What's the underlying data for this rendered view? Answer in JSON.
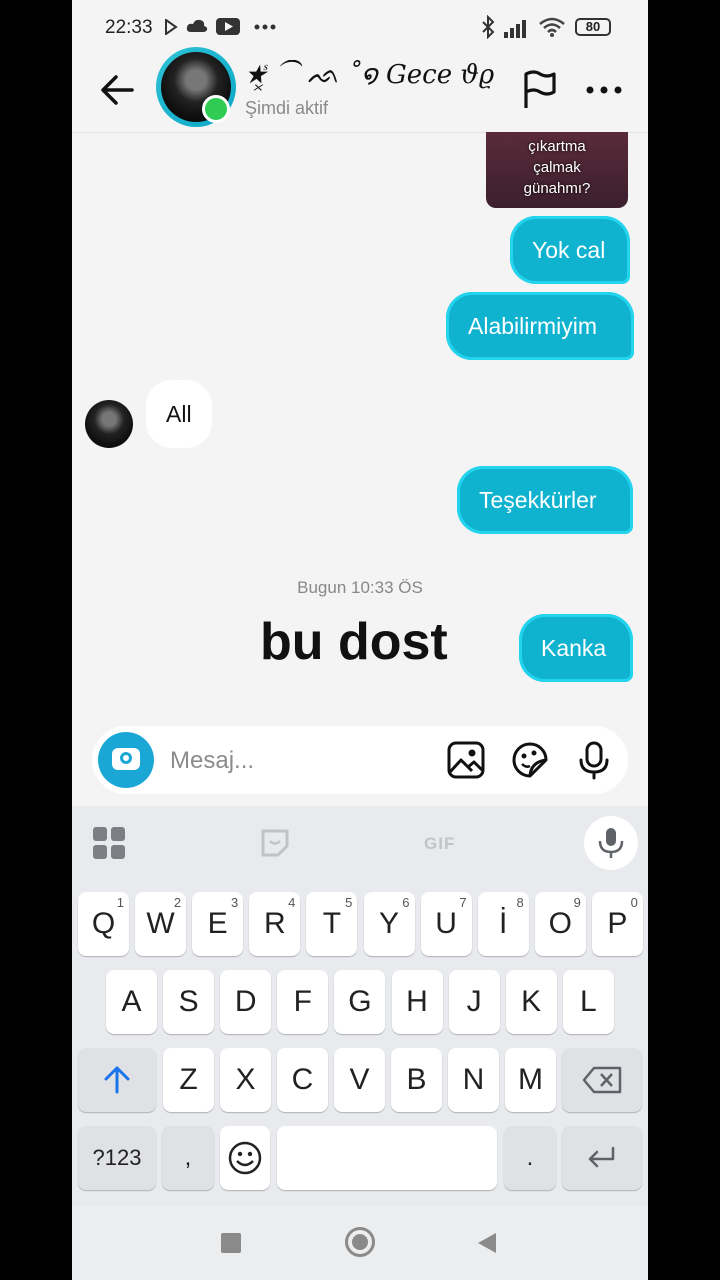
{
  "status_bar": {
    "time": "22:33",
    "battery": "80",
    "icons": [
      "play-store-icon",
      "cloud-icon",
      "youtube-icon",
      "more-dots-icon",
      "bluetooth-icon",
      "signal-icon",
      "wifi-icon",
      "battery-icon"
    ]
  },
  "header": {
    "contact_name": "★͓ᷤ ⁀ ᨒ ˚໑ Gece ϑϱ˚...",
    "status": "Şimdi aktif",
    "icons": [
      "back-arrow-icon",
      "flag-icon",
      "more-options-icon"
    ],
    "online_color": "#2ecc52"
  },
  "messages": [
    {
      "direction": "outgoing",
      "type": "sticker",
      "text": "çıkartma\nçalmak\ngünahmı?"
    },
    {
      "direction": "outgoing",
      "text": "Yok cal"
    },
    {
      "direction": "outgoing",
      "text": "Alabilirmiyim"
    },
    {
      "direction": "incoming",
      "text": "All"
    },
    {
      "direction": "outgoing",
      "text": "Teşekkürler"
    },
    {
      "direction": "outgoing",
      "text": "Kanka"
    }
  ],
  "timestamp": "Bugun 10:33 ÖS",
  "overlay_text": "bu dost",
  "composer": {
    "placeholder": "Mesaj...",
    "icons": [
      "camera-icon",
      "gallery-icon",
      "sticker-icon",
      "microphone-icon"
    ]
  },
  "keyboard": {
    "gif_label": "GIF",
    "rows": [
      [
        {
          "k": "Q",
          "n": "1"
        },
        {
          "k": "W",
          "n": "2"
        },
        {
          "k": "E",
          "n": "3"
        },
        {
          "k": "R",
          "n": "4"
        },
        {
          "k": "T",
          "n": "5"
        },
        {
          "k": "Y",
          "n": "6"
        },
        {
          "k": "U",
          "n": "7"
        },
        {
          "k": "İ",
          "n": "8"
        },
        {
          "k": "O",
          "n": "9"
        },
        {
          "k": "P",
          "n": "0"
        }
      ],
      [
        {
          "k": "A"
        },
        {
          "k": "S"
        },
        {
          "k": "D"
        },
        {
          "k": "F"
        },
        {
          "k": "G"
        },
        {
          "k": "H"
        },
        {
          "k": "J"
        },
        {
          "k": "K"
        },
        {
          "k": "L"
        }
      ],
      [
        {
          "k": "Z"
        },
        {
          "k": "X"
        },
        {
          "k": "C"
        },
        {
          "k": "V"
        },
        {
          "k": "B"
        },
        {
          "k": "N"
        },
        {
          "k": "M"
        }
      ]
    ],
    "symbols_key": "?123",
    "comma_key": ",",
    "period_key": ".",
    "accent_color": "#1a73e8"
  },
  "nav_bar": {
    "icons": [
      "recents-square-icon",
      "home-circle-icon",
      "back-triangle-icon"
    ]
  },
  "colors": {
    "outgoing_bubble": "#10b3cf",
    "incoming_bubble": "#ffffff",
    "background": "#f4f4f4"
  }
}
